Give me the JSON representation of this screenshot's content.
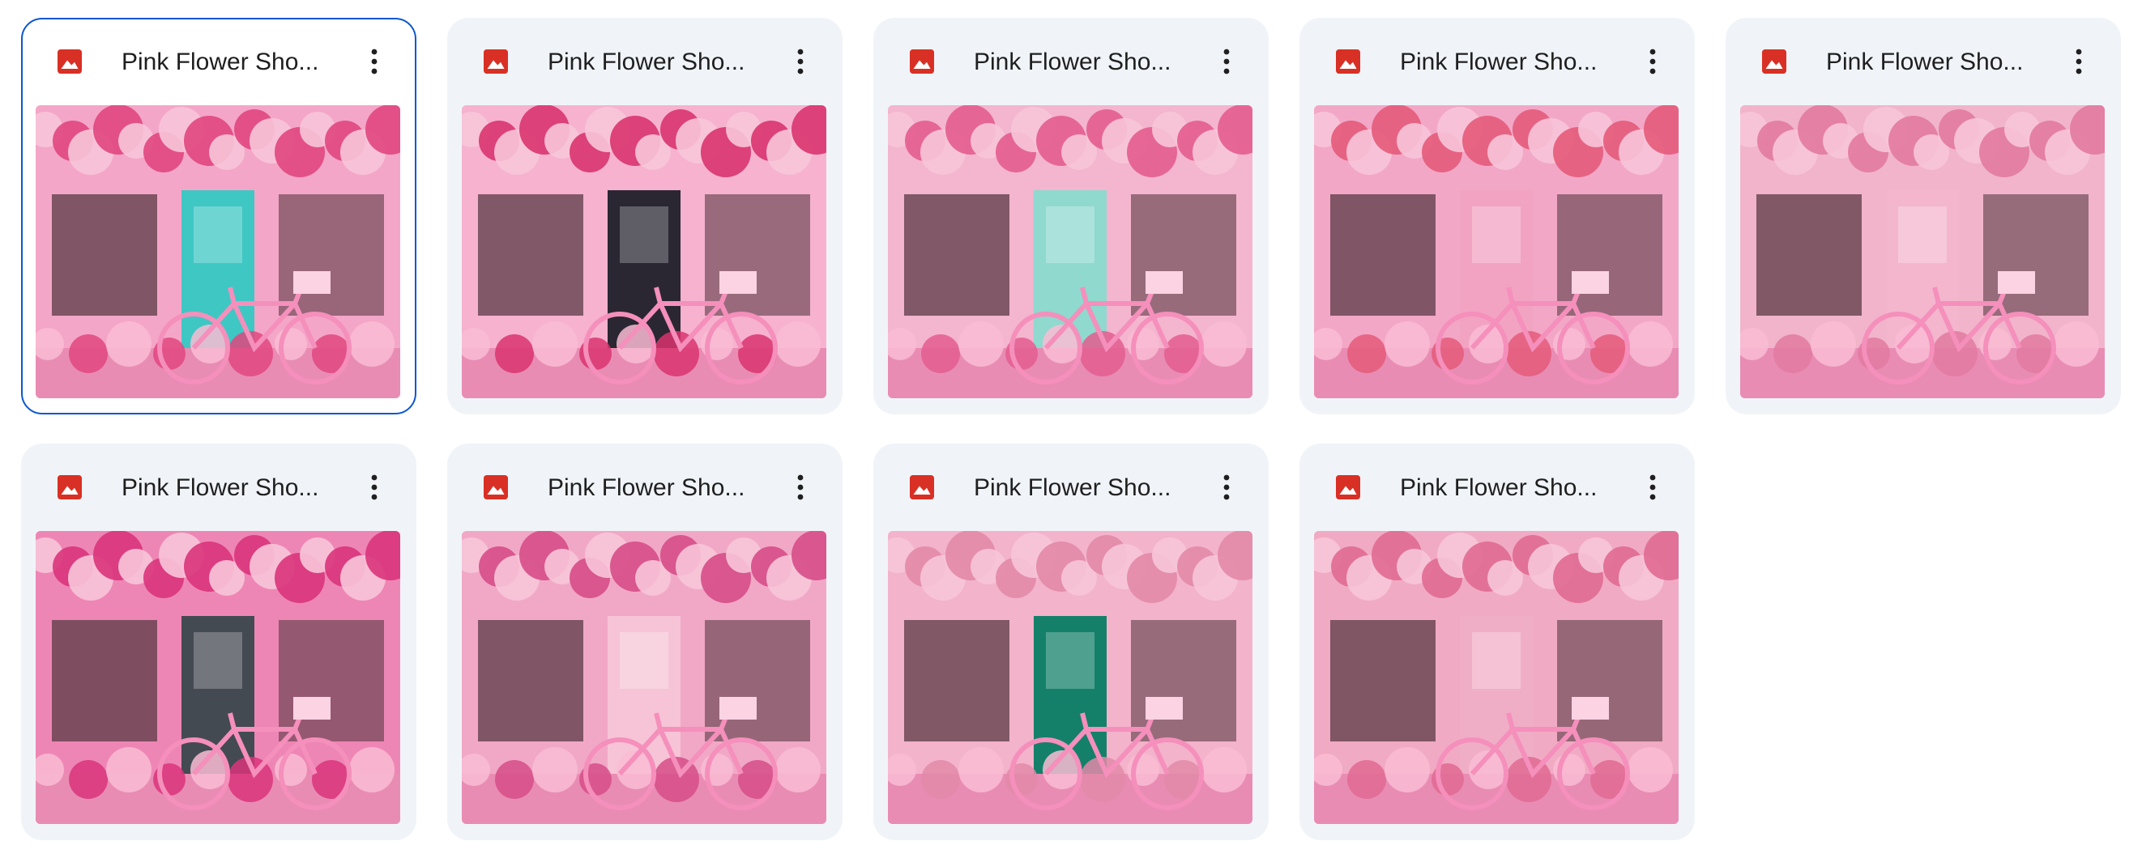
{
  "files": [
    {
      "name": "Pink Flower Sho...",
      "icon": "image-file-icon",
      "selected": true,
      "door": "#3fc7c4",
      "bg": "#f4a6c8",
      "accent": "#e0477f"
    },
    {
      "name": "Pink Flower Sho...",
      "icon": "image-file-icon",
      "selected": false,
      "door": "#2a2733",
      "bg": "#f6b2cf",
      "accent": "#d9346f"
    },
    {
      "name": "Pink Flower Sho...",
      "icon": "image-file-icon",
      "selected": false,
      "door": "#8fd9cf",
      "bg": "#f4b5ce",
      "accent": "#e35d8f"
    },
    {
      "name": "Pink Flower Sho...",
      "icon": "image-file-icon",
      "selected": false,
      "door": "#f2a3c2",
      "bg": "#f3a7c7",
      "accent": "#e45b7a"
    },
    {
      "name": "Pink Flower Sho...",
      "icon": "image-file-icon",
      "selected": false,
      "door": "#f3b6cd",
      "bg": "#f1b4cb",
      "accent": "#e27aa0"
    },
    {
      "name": "Pink Flower Sho...",
      "icon": "image-file-icon",
      "selected": false,
      "door": "#444a52",
      "bg": "#ee86b5",
      "accent": "#d9347b"
    },
    {
      "name": "Pink Flower Sho...",
      "icon": "image-file-icon",
      "selected": false,
      "door": "#f6c4d6",
      "bg": "#f1a8c6",
      "accent": "#d64d87"
    },
    {
      "name": "Pink Flower Sho...",
      "icon": "image-file-icon",
      "selected": false,
      "door": "#15806a",
      "bg": "#f3b3cb",
      "accent": "#e28aa8"
    },
    {
      "name": "Pink Flower Sho...",
      "icon": "image-file-icon",
      "selected": false,
      "door": "#f0aec6",
      "bg": "#f1aac3",
      "accent": "#e06a92"
    }
  ],
  "colors": {
    "card_bg": "#f0f4f9",
    "selected_border": "#0b57d0",
    "image_icon_red": "#d93025",
    "text": "#1f1f1f"
  }
}
